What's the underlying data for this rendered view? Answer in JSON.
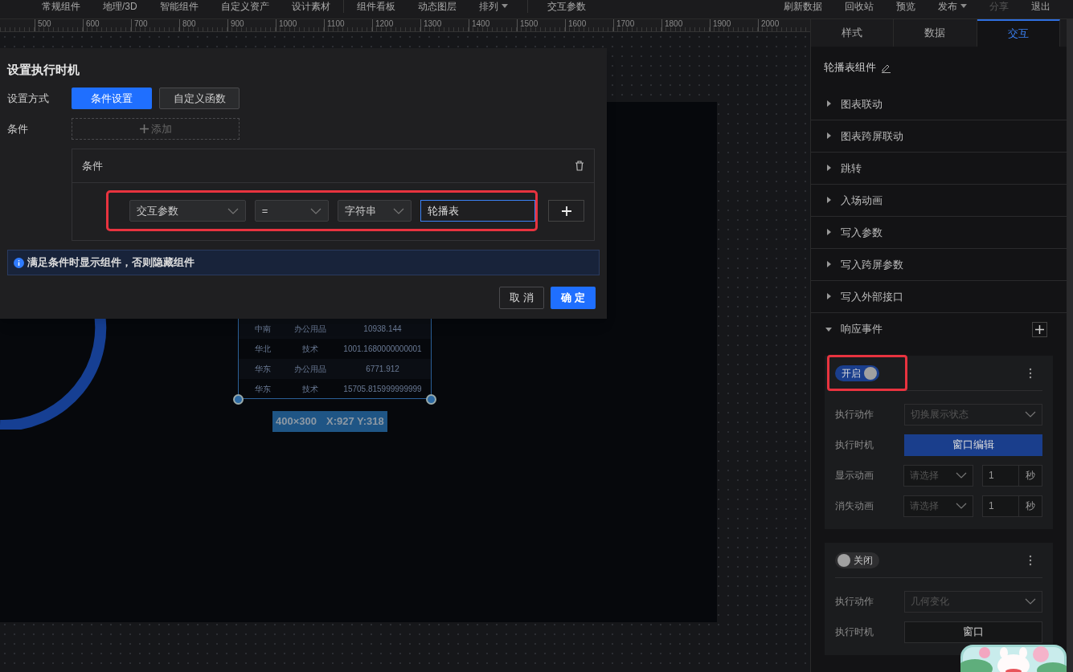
{
  "top_menu": {
    "left": [
      {
        "label": "常规组件",
        "dropdown": false
      },
      {
        "label": "地理/3D",
        "dropdown": false
      },
      {
        "label": "智能组件",
        "dropdown": false
      },
      {
        "label": "自定义资产",
        "dropdown": false
      },
      {
        "label": "设计素材",
        "dropdown": false
      }
    ],
    "middle": [
      {
        "label": "组件看板",
        "dropdown": false
      },
      {
        "label": "动态图层",
        "dropdown": false
      },
      {
        "label": "排列",
        "dropdown": true
      }
    ],
    "params": {
      "label": "交互参数",
      "dropdown": false
    },
    "right": [
      {
        "label": "刷新数据",
        "dropdown": false,
        "disabled": false
      },
      {
        "label": "回收站",
        "dropdown": false,
        "disabled": false
      },
      {
        "label": "预览",
        "dropdown": false,
        "disabled": false
      },
      {
        "label": "发布",
        "dropdown": true,
        "disabled": false
      },
      {
        "label": "分享",
        "dropdown": false,
        "disabled": true
      },
      {
        "label": "退出",
        "dropdown": false,
        "disabled": false
      }
    ]
  },
  "ruler": [
    "500",
    "600",
    "700",
    "800",
    "900",
    "1000",
    "1100",
    "1200",
    "1300",
    "1400",
    "1500",
    "1600",
    "1700",
    "1800",
    "1900",
    "2000"
  ],
  "canvas": {
    "table_rows": [
      [
        "中南",
        "办公用品",
        "10938.144"
      ],
      [
        "华北",
        "技术",
        "1001.1680000000001"
      ],
      [
        "华东",
        "办公用品",
        "6771.912"
      ],
      [
        "华东",
        "技术",
        "15705.815999999999"
      ]
    ],
    "size_label": "400×300",
    "position_label": "X:927 Y:318"
  },
  "dialog": {
    "title": "设置执行时机",
    "method_label": "设置方式",
    "method_options": [
      {
        "label": "条件设置",
        "selected": true
      },
      {
        "label": "自定义函数",
        "selected": false
      }
    ],
    "condition_label": "条件",
    "add_label": "添加",
    "condition_card": {
      "title": "条件",
      "highlighted": true,
      "param": "交互参数",
      "operator": "=",
      "type": "字符串",
      "value": "轮播表"
    },
    "info": "满足条件时显示组件，否则隐藏组件",
    "cancel": "取 消",
    "confirm": "确 定"
  },
  "panel": {
    "tabs": [
      {
        "label": "样式",
        "selected": false
      },
      {
        "label": "数据",
        "selected": false
      },
      {
        "label": "交互",
        "selected": true
      }
    ],
    "component_name": "轮播表组件",
    "sections": [
      {
        "label": "图表联动",
        "expanded": false
      },
      {
        "label": "图表跨屏联动",
        "expanded": false
      },
      {
        "label": "跳转",
        "expanded": false
      },
      {
        "label": "入场动画",
        "expanded": false
      },
      {
        "label": "写入参数",
        "expanded": false
      },
      {
        "label": "写入跨屏参数",
        "expanded": false
      },
      {
        "label": "写入外部接口",
        "expanded": false
      },
      {
        "label": "响应事件",
        "expanded": true
      }
    ],
    "events": [
      {
        "on": true,
        "highlighted": true,
        "toggle_label": "开启",
        "fields": [
          {
            "kind": "select",
            "label": "执行动作",
            "value": "切换展示状态",
            "disabled": true
          },
          {
            "kind": "button",
            "label": "执行时机",
            "value": "窗口编辑"
          },
          {
            "kind": "select_duration",
            "label": "显示动画",
            "placeholder": "请选择",
            "duration": "1",
            "unit": "秒"
          },
          {
            "kind": "select_duration",
            "label": "消失动画",
            "placeholder": "请选择",
            "duration": "1",
            "unit": "秒"
          }
        ]
      },
      {
        "on": false,
        "highlighted": false,
        "toggle_label": "关闭",
        "fields": [
          {
            "kind": "select",
            "label": "执行动作",
            "value": "几何变化",
            "disabled": true
          },
          {
            "kind": "button",
            "label": "执行时机",
            "value": "窗口"
          }
        ]
      }
    ]
  }
}
